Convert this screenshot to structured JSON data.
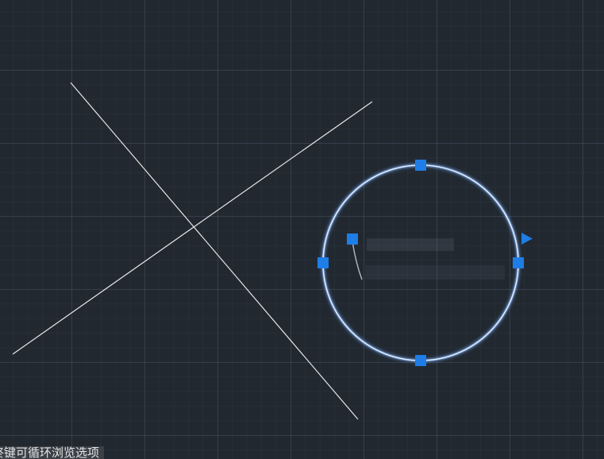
{
  "status_bar": {
    "hint_text": "终键可循环浏览选项"
  },
  "colors": {
    "background": "#212830",
    "entity_line": "#e8e8e8",
    "selected_circle": "#cfe3ff",
    "grip": "#1e7de6"
  },
  "icons": {
    "grip": "blue-square-grip-icon",
    "direction": "blue-triangle-arrow-icon"
  }
}
